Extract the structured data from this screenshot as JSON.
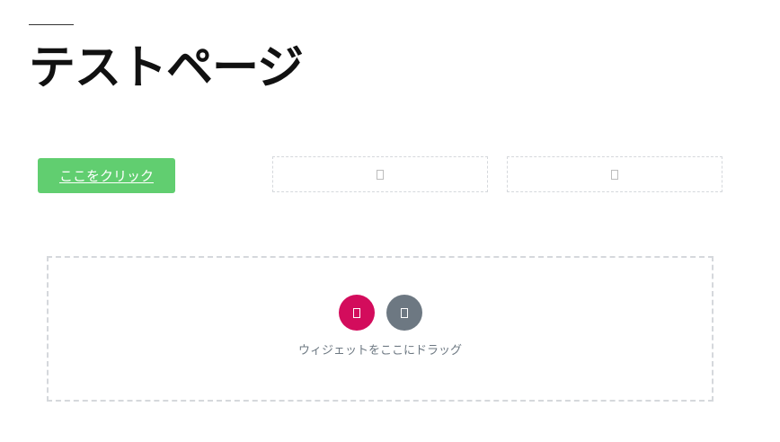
{
  "page": {
    "title": "テストページ"
  },
  "cta": {
    "label": "ここをクリック"
  },
  "placeholders": [
    {
      "icon": "missing-glyph-icon"
    },
    {
      "icon": "missing-glyph-icon"
    }
  ],
  "drop_zone": {
    "add_button_icon": "missing-glyph-icon",
    "template_button_icon": "missing-glyph-icon",
    "label": "ウィジェットをここにドラッグ"
  },
  "colors": {
    "cta_background": "#61ce70",
    "add_button": "#d30c5c",
    "template_button": "#6d7882",
    "dashed_border": "#d5d8dc"
  }
}
